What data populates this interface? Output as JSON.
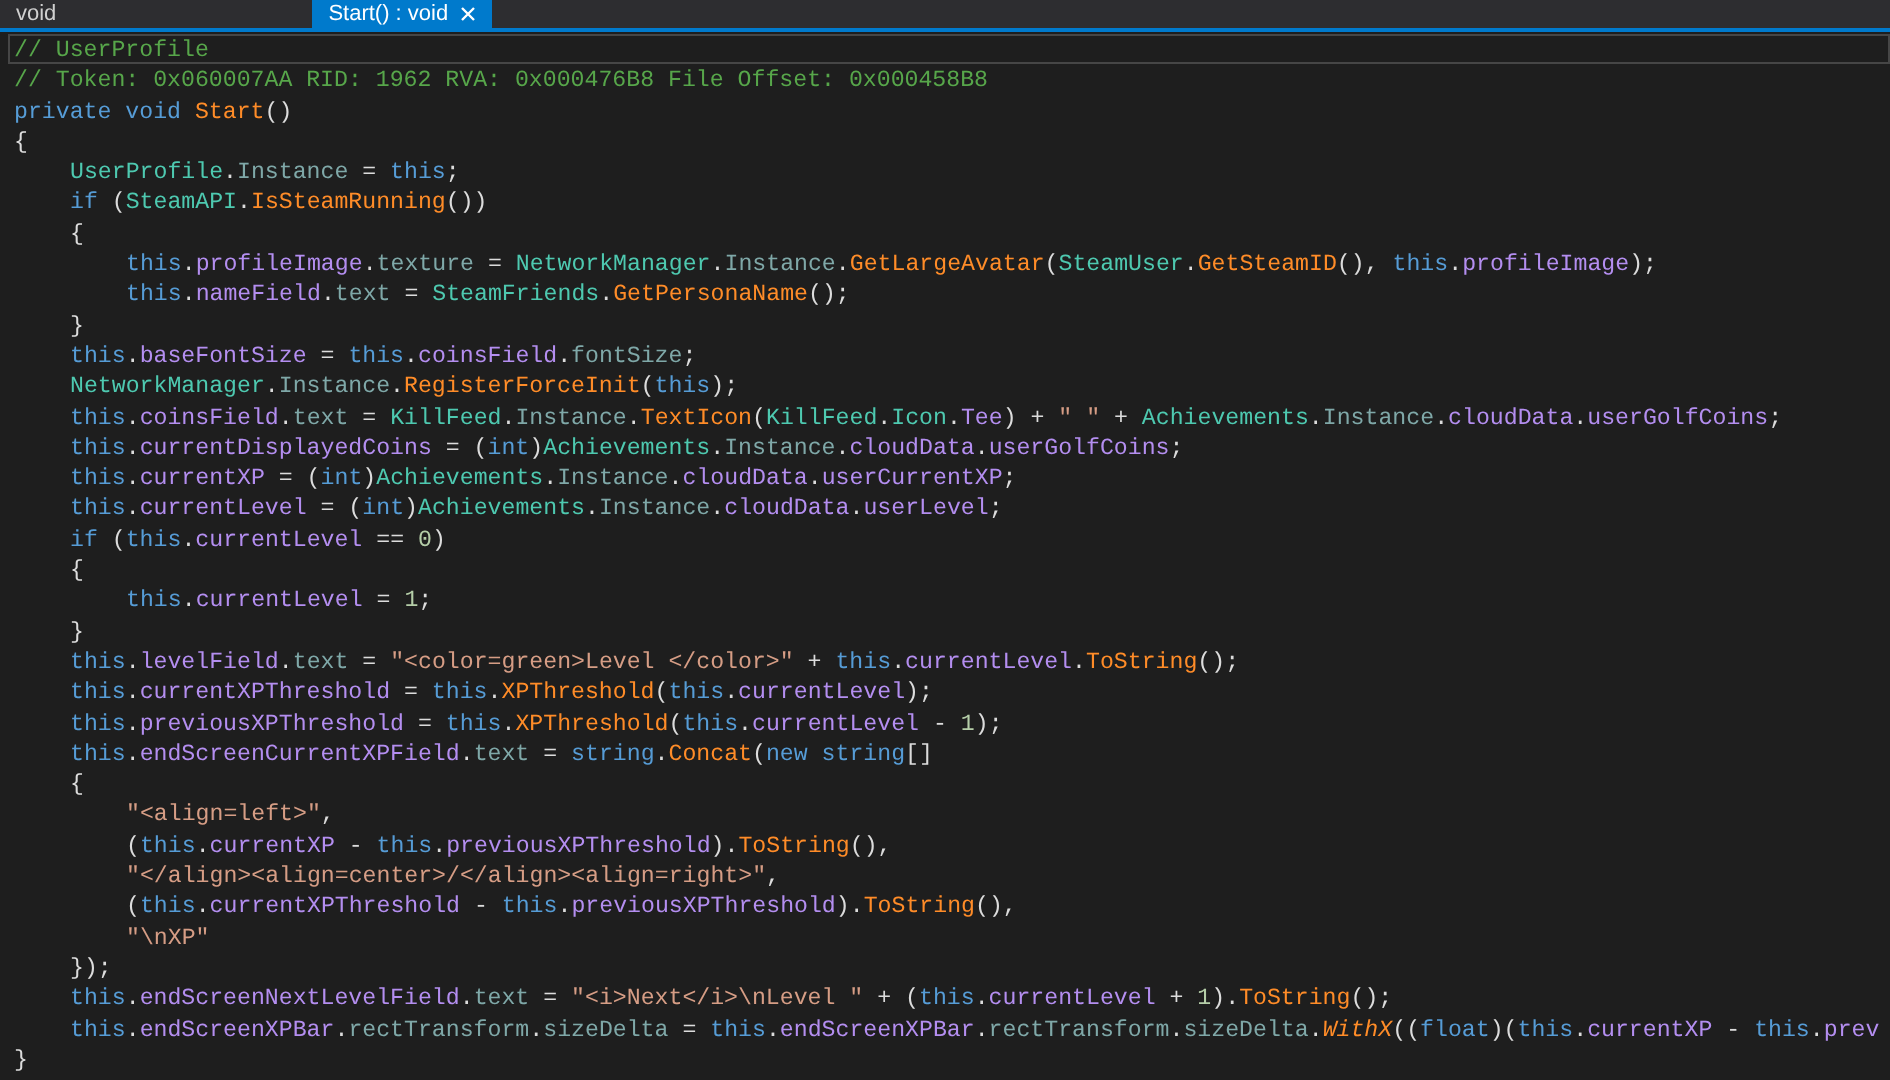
{
  "tabs": [
    {
      "label": "void",
      "selected": false
    },
    {
      "label": "Start() : void",
      "selected": true
    }
  ],
  "code_lines": [
    {
      "current": true,
      "tokens": [
        {
          "kind": "comment",
          "text": "// UserProfile"
        }
      ]
    },
    {
      "current": false,
      "tokens": [
        {
          "kind": "comment",
          "text": "// Token: 0x060007AA RID: 1962 RVA: 0x000476B8 File Offset: 0x000458B8"
        }
      ]
    },
    {
      "current": false,
      "tokens": [
        {
          "kind": "keyword",
          "text": "private void "
        },
        {
          "kind": "method",
          "text": "Start"
        },
        {
          "kind": "plain",
          "text": "()"
        }
      ]
    },
    {
      "current": false,
      "tokens": [
        {
          "kind": "plain",
          "text": "{"
        }
      ],
      "children": [
        {
          "current": false,
          "tokens": [
            {
              "kind": "type",
              "text": "UserProfile"
            },
            {
              "kind": "plain",
              "text": "."
            },
            {
              "kind": "property",
              "text": "Instance"
            },
            {
              "kind": "plain",
              "text": " = "
            },
            {
              "kind": "keyword",
              "text": "this"
            },
            {
              "kind": "plain",
              "text": ";"
            }
          ]
        },
        {
          "current": false,
          "tokens": [
            {
              "kind": "keyword",
              "text": "if"
            },
            {
              "kind": "plain",
              "text": " ("
            },
            {
              "kind": "type",
              "text": "SteamAPI"
            },
            {
              "kind": "plain",
              "text": "."
            },
            {
              "kind": "method",
              "text": "IsSteamRunning"
            },
            {
              "kind": "plain",
              "text": "())"
            }
          ]
        },
        {
          "current": false,
          "tokens": [
            {
              "kind": "plain",
              "text": "{"
            }
          ],
          "children": [
            {
              "current": false,
              "tokens": [
                {
                  "kind": "keyword",
                  "text": "this"
                },
                {
                  "kind": "plain",
                  "text": "."
                },
                {
                  "kind": "field",
                  "text": "profileImage"
                },
                {
                  "kind": "plain",
                  "text": "."
                },
                {
                  "kind": "property",
                  "text": "texture"
                },
                {
                  "kind": "plain",
                  "text": " = "
                },
                {
                  "kind": "type",
                  "text": "NetworkManager"
                },
                {
                  "kind": "plain",
                  "text": "."
                },
                {
                  "kind": "property",
                  "text": "Instance"
                },
                {
                  "kind": "plain",
                  "text": "."
                },
                {
                  "kind": "method",
                  "text": "GetLargeAvatar"
                },
                {
                  "kind": "plain",
                  "text": "("
                },
                {
                  "kind": "type",
                  "text": "SteamUser"
                },
                {
                  "kind": "plain",
                  "text": "."
                },
                {
                  "kind": "method",
                  "text": "GetSteamID"
                },
                {
                  "kind": "plain",
                  "text": "(), "
                },
                {
                  "kind": "keyword",
                  "text": "this"
                },
                {
                  "kind": "plain",
                  "text": "."
                },
                {
                  "kind": "field",
                  "text": "profileImage"
                },
                {
                  "kind": "plain",
                  "text": ");"
                }
              ]
            },
            {
              "current": false,
              "tokens": [
                {
                  "kind": "keyword",
                  "text": "this"
                },
                {
                  "kind": "plain",
                  "text": "."
                },
                {
                  "kind": "field",
                  "text": "nameField"
                },
                {
                  "kind": "plain",
                  "text": "."
                },
                {
                  "kind": "property",
                  "text": "text"
                },
                {
                  "kind": "plain",
                  "text": " = "
                },
                {
                  "kind": "type",
                  "text": "SteamFriends"
                },
                {
                  "kind": "plain",
                  "text": "."
                },
                {
                  "kind": "method",
                  "text": "GetPersonaName"
                },
                {
                  "kind": "plain",
                  "text": "();"
                }
              ]
            }
          ]
        },
        {
          "current": false,
          "tokens": [
            {
              "kind": "plain",
              "text": "}"
            }
          ]
        },
        {
          "current": false,
          "tokens": [
            {
              "kind": "keyword",
              "text": "this"
            },
            {
              "kind": "plain",
              "text": "."
            },
            {
              "kind": "field",
              "text": "baseFontSize"
            },
            {
              "kind": "plain",
              "text": " = "
            },
            {
              "kind": "keyword",
              "text": "this"
            },
            {
              "kind": "plain",
              "text": "."
            },
            {
              "kind": "field",
              "text": "coinsField"
            },
            {
              "kind": "plain",
              "text": "."
            },
            {
              "kind": "property",
              "text": "fontSize"
            },
            {
              "kind": "plain",
              "text": ";"
            }
          ]
        },
        {
          "current": false,
          "tokens": [
            {
              "kind": "type",
              "text": "NetworkManager"
            },
            {
              "kind": "plain",
              "text": "."
            },
            {
              "kind": "property",
              "text": "Instance"
            },
            {
              "kind": "plain",
              "text": "."
            },
            {
              "kind": "method",
              "text": "RegisterForceInit"
            },
            {
              "kind": "plain",
              "text": "("
            },
            {
              "kind": "keyword",
              "text": "this"
            },
            {
              "kind": "plain",
              "text": ");"
            }
          ]
        },
        {
          "current": false,
          "tokens": [
            {
              "kind": "keyword",
              "text": "this"
            },
            {
              "kind": "plain",
              "text": "."
            },
            {
              "kind": "field",
              "text": "coinsField"
            },
            {
              "kind": "plain",
              "text": "."
            },
            {
              "kind": "property",
              "text": "text"
            },
            {
              "kind": "plain",
              "text": " = "
            },
            {
              "kind": "type",
              "text": "KillFeed"
            },
            {
              "kind": "plain",
              "text": "."
            },
            {
              "kind": "property",
              "text": "Instance"
            },
            {
              "kind": "plain",
              "text": "."
            },
            {
              "kind": "method",
              "text": "TextIcon"
            },
            {
              "kind": "plain",
              "text": "("
            },
            {
              "kind": "type",
              "text": "KillFeed"
            },
            {
              "kind": "plain",
              "text": "."
            },
            {
              "kind": "type",
              "text": "Icon"
            },
            {
              "kind": "plain",
              "text": "."
            },
            {
              "kind": "field",
              "text": "Tee"
            },
            {
              "kind": "plain",
              "text": ") + "
            },
            {
              "kind": "string",
              "text": "\" \""
            },
            {
              "kind": "plain",
              "text": " + "
            },
            {
              "kind": "type",
              "text": "Achievements"
            },
            {
              "kind": "plain",
              "text": "."
            },
            {
              "kind": "property",
              "text": "Instance"
            },
            {
              "kind": "plain",
              "text": "."
            },
            {
              "kind": "field",
              "text": "cloudData"
            },
            {
              "kind": "plain",
              "text": "."
            },
            {
              "kind": "field",
              "text": "userGolfCoins"
            },
            {
              "kind": "plain",
              "text": ";"
            }
          ]
        },
        {
          "current": false,
          "tokens": [
            {
              "kind": "keyword",
              "text": "this"
            },
            {
              "kind": "plain",
              "text": "."
            },
            {
              "kind": "field",
              "text": "currentDisplayedCoins"
            },
            {
              "kind": "plain",
              "text": " = ("
            },
            {
              "kind": "keyword",
              "text": "int"
            },
            {
              "kind": "plain",
              "text": ")"
            },
            {
              "kind": "type",
              "text": "Achievements"
            },
            {
              "kind": "plain",
              "text": "."
            },
            {
              "kind": "property",
              "text": "Instance"
            },
            {
              "kind": "plain",
              "text": "."
            },
            {
              "kind": "field",
              "text": "cloudData"
            },
            {
              "kind": "plain",
              "text": "."
            },
            {
              "kind": "field",
              "text": "userGolfCoins"
            },
            {
              "kind": "plain",
              "text": ";"
            }
          ]
        },
        {
          "current": false,
          "tokens": [
            {
              "kind": "keyword",
              "text": "this"
            },
            {
              "kind": "plain",
              "text": "."
            },
            {
              "kind": "field",
              "text": "currentXP"
            },
            {
              "kind": "plain",
              "text": " = ("
            },
            {
              "kind": "keyword",
              "text": "int"
            },
            {
              "kind": "plain",
              "text": ")"
            },
            {
              "kind": "type",
              "text": "Achievements"
            },
            {
              "kind": "plain",
              "text": "."
            },
            {
              "kind": "property",
              "text": "Instance"
            },
            {
              "kind": "plain",
              "text": "."
            },
            {
              "kind": "field",
              "text": "cloudData"
            },
            {
              "kind": "plain",
              "text": "."
            },
            {
              "kind": "field",
              "text": "userCurrentXP"
            },
            {
              "kind": "plain",
              "text": ";"
            }
          ]
        },
        {
          "current": false,
          "tokens": [
            {
              "kind": "keyword",
              "text": "this"
            },
            {
              "kind": "plain",
              "text": "."
            },
            {
              "kind": "field",
              "text": "currentLevel"
            },
            {
              "kind": "plain",
              "text": " = ("
            },
            {
              "kind": "keyword",
              "text": "int"
            },
            {
              "kind": "plain",
              "text": ")"
            },
            {
              "kind": "type",
              "text": "Achievements"
            },
            {
              "kind": "plain",
              "text": "."
            },
            {
              "kind": "property",
              "text": "Instance"
            },
            {
              "kind": "plain",
              "text": "."
            },
            {
              "kind": "field",
              "text": "cloudData"
            },
            {
              "kind": "plain",
              "text": "."
            },
            {
              "kind": "field",
              "text": "userLevel"
            },
            {
              "kind": "plain",
              "text": ";"
            }
          ]
        },
        {
          "current": false,
          "tokens": [
            {
              "kind": "keyword",
              "text": "if"
            },
            {
              "kind": "plain",
              "text": " ("
            },
            {
              "kind": "keyword",
              "text": "this"
            },
            {
              "kind": "plain",
              "text": "."
            },
            {
              "kind": "field",
              "text": "currentLevel"
            },
            {
              "kind": "plain",
              "text": " == "
            },
            {
              "kind": "number",
              "text": "0"
            },
            {
              "kind": "plain",
              "text": ")"
            }
          ]
        },
        {
          "current": false,
          "tokens": [
            {
              "kind": "plain",
              "text": "{"
            }
          ],
          "children": [
            {
              "current": false,
              "tokens": [
                {
                  "kind": "keyword",
                  "text": "this"
                },
                {
                  "kind": "plain",
                  "text": "."
                },
                {
                  "kind": "field",
                  "text": "currentLevel"
                },
                {
                  "kind": "plain",
                  "text": " = "
                },
                {
                  "kind": "number",
                  "text": "1"
                },
                {
                  "kind": "plain",
                  "text": ";"
                }
              ]
            }
          ]
        },
        {
          "current": false,
          "tokens": [
            {
              "kind": "plain",
              "text": "}"
            }
          ]
        },
        {
          "current": false,
          "tokens": [
            {
              "kind": "keyword",
              "text": "this"
            },
            {
              "kind": "plain",
              "text": "."
            },
            {
              "kind": "field",
              "text": "levelField"
            },
            {
              "kind": "plain",
              "text": "."
            },
            {
              "kind": "property",
              "text": "text"
            },
            {
              "kind": "plain",
              "text": " = "
            },
            {
              "kind": "string",
              "text": "\"<color=green>Level </color>\""
            },
            {
              "kind": "plain",
              "text": " + "
            },
            {
              "kind": "keyword",
              "text": "this"
            },
            {
              "kind": "plain",
              "text": "."
            },
            {
              "kind": "field",
              "text": "currentLevel"
            },
            {
              "kind": "plain",
              "text": "."
            },
            {
              "kind": "method",
              "text": "ToString"
            },
            {
              "kind": "plain",
              "text": "();"
            }
          ]
        },
        {
          "current": false,
          "tokens": [
            {
              "kind": "keyword",
              "text": "this"
            },
            {
              "kind": "plain",
              "text": "."
            },
            {
              "kind": "field",
              "text": "currentXPThreshold"
            },
            {
              "kind": "plain",
              "text": " = "
            },
            {
              "kind": "keyword",
              "text": "this"
            },
            {
              "kind": "plain",
              "text": "."
            },
            {
              "kind": "method",
              "text": "XPThreshold"
            },
            {
              "kind": "plain",
              "text": "("
            },
            {
              "kind": "keyword",
              "text": "this"
            },
            {
              "kind": "plain",
              "text": "."
            },
            {
              "kind": "field",
              "text": "currentLevel"
            },
            {
              "kind": "plain",
              "text": ");"
            }
          ]
        },
        {
          "current": false,
          "tokens": [
            {
              "kind": "keyword",
              "text": "this"
            },
            {
              "kind": "plain",
              "text": "."
            },
            {
              "kind": "field",
              "text": "previousXPThreshold"
            },
            {
              "kind": "plain",
              "text": " = "
            },
            {
              "kind": "keyword",
              "text": "this"
            },
            {
              "kind": "plain",
              "text": "."
            },
            {
              "kind": "method",
              "text": "XPThreshold"
            },
            {
              "kind": "plain",
              "text": "("
            },
            {
              "kind": "keyword",
              "text": "this"
            },
            {
              "kind": "plain",
              "text": "."
            },
            {
              "kind": "field",
              "text": "currentLevel"
            },
            {
              "kind": "plain",
              "text": " - "
            },
            {
              "kind": "number",
              "text": "1"
            },
            {
              "kind": "plain",
              "text": ");"
            }
          ]
        },
        {
          "current": false,
          "tokens": [
            {
              "kind": "keyword",
              "text": "this"
            },
            {
              "kind": "plain",
              "text": "."
            },
            {
              "kind": "field",
              "text": "endScreenCurrentXPField"
            },
            {
              "kind": "plain",
              "text": "."
            },
            {
              "kind": "property",
              "text": "text"
            },
            {
              "kind": "plain",
              "text": " = "
            },
            {
              "kind": "keyword",
              "text": "string"
            },
            {
              "kind": "plain",
              "text": "."
            },
            {
              "kind": "method",
              "text": "Concat"
            },
            {
              "kind": "plain",
              "text": "("
            },
            {
              "kind": "keyword",
              "text": "new string"
            },
            {
              "kind": "plain",
              "text": "[]"
            }
          ]
        },
        {
          "current": false,
          "tokens": [
            {
              "kind": "plain",
              "text": "{"
            }
          ],
          "children": [
            {
              "current": false,
              "tokens": [
                {
                  "kind": "string",
                  "text": "\"<align=left>\""
                },
                {
                  "kind": "plain",
                  "text": ","
                }
              ]
            },
            {
              "current": false,
              "tokens": [
                {
                  "kind": "plain",
                  "text": "("
                },
                {
                  "kind": "keyword",
                  "text": "this"
                },
                {
                  "kind": "plain",
                  "text": "."
                },
                {
                  "kind": "field",
                  "text": "currentXP"
                },
                {
                  "kind": "plain",
                  "text": " - "
                },
                {
                  "kind": "keyword",
                  "text": "this"
                },
                {
                  "kind": "plain",
                  "text": "."
                },
                {
                  "kind": "field",
                  "text": "previousXPThreshold"
                },
                {
                  "kind": "plain",
                  "text": ")."
                },
                {
                  "kind": "method",
                  "text": "ToString"
                },
                {
                  "kind": "plain",
                  "text": "(),"
                }
              ]
            },
            {
              "current": false,
              "tokens": [
                {
                  "kind": "string",
                  "text": "\"</align><align=center>/</align><align=right>\""
                },
                {
                  "kind": "plain",
                  "text": ","
                }
              ]
            },
            {
              "current": false,
              "tokens": [
                {
                  "kind": "plain",
                  "text": "("
                },
                {
                  "kind": "keyword",
                  "text": "this"
                },
                {
                  "kind": "plain",
                  "text": "."
                },
                {
                  "kind": "field",
                  "text": "currentXPThreshold"
                },
                {
                  "kind": "plain",
                  "text": " - "
                },
                {
                  "kind": "keyword",
                  "text": "this"
                },
                {
                  "kind": "plain",
                  "text": "."
                },
                {
                  "kind": "field",
                  "text": "previousXPThreshold"
                },
                {
                  "kind": "plain",
                  "text": ")."
                },
                {
                  "kind": "method",
                  "text": "ToString"
                },
                {
                  "kind": "plain",
                  "text": "(),"
                }
              ]
            },
            {
              "current": false,
              "tokens": [
                {
                  "kind": "string",
                  "text": "\"\\nXP\""
                }
              ]
            }
          ]
        },
        {
          "current": false,
          "tokens": [
            {
              "kind": "plain",
              "text": "});"
            }
          ]
        },
        {
          "current": false,
          "tokens": [
            {
              "kind": "keyword",
              "text": "this"
            },
            {
              "kind": "plain",
              "text": "."
            },
            {
              "kind": "field",
              "text": "endScreenNextLevelField"
            },
            {
              "kind": "plain",
              "text": "."
            },
            {
              "kind": "property",
              "text": "text"
            },
            {
              "kind": "plain",
              "text": " = "
            },
            {
              "kind": "string",
              "text": "\"<i>Next</i>\\nLevel \""
            },
            {
              "kind": "plain",
              "text": " + ("
            },
            {
              "kind": "keyword",
              "text": "this"
            },
            {
              "kind": "plain",
              "text": "."
            },
            {
              "kind": "field",
              "text": "currentLevel"
            },
            {
              "kind": "plain",
              "text": " + "
            },
            {
              "kind": "number",
              "text": "1"
            },
            {
              "kind": "plain",
              "text": ")."
            },
            {
              "kind": "method",
              "text": "ToString"
            },
            {
              "kind": "plain",
              "text": "();"
            }
          ]
        },
        {
          "current": false,
          "tokens": [
            {
              "kind": "keyword",
              "text": "this"
            },
            {
              "kind": "plain",
              "text": "."
            },
            {
              "kind": "field",
              "text": "endScreenXPBar"
            },
            {
              "kind": "plain",
              "text": "."
            },
            {
              "kind": "property",
              "text": "rectTransform"
            },
            {
              "kind": "plain",
              "text": "."
            },
            {
              "kind": "property",
              "text": "sizeDelta"
            },
            {
              "kind": "plain",
              "text": " = "
            },
            {
              "kind": "keyword",
              "text": "this"
            },
            {
              "kind": "plain",
              "text": "."
            },
            {
              "kind": "field",
              "text": "endScreenXPBar"
            },
            {
              "kind": "plain",
              "text": "."
            },
            {
              "kind": "property",
              "text": "rectTransform"
            },
            {
              "kind": "plain",
              "text": "."
            },
            {
              "kind": "property",
              "text": "sizeDelta"
            },
            {
              "kind": "plain",
              "text": "."
            },
            {
              "kind": "extension",
              "text": "WithX"
            },
            {
              "kind": "plain",
              "text": "(("
            },
            {
              "kind": "keyword",
              "text": "float"
            },
            {
              "kind": "plain",
              "text": ")("
            },
            {
              "kind": "keyword",
              "text": "this"
            },
            {
              "kind": "plain",
              "text": "."
            },
            {
              "kind": "field",
              "text": "currentXP"
            },
            {
              "kind": "plain",
              "text": " - "
            },
            {
              "kind": "keyword",
              "text": "this"
            },
            {
              "kind": "plain",
              "text": "."
            },
            {
              "kind": "field",
              "text": "prev"
            }
          ]
        }
      ]
    },
    {
      "current": false,
      "tokens": [
        {
          "kind": "plain",
          "text": "}"
        }
      ]
    }
  ]
}
